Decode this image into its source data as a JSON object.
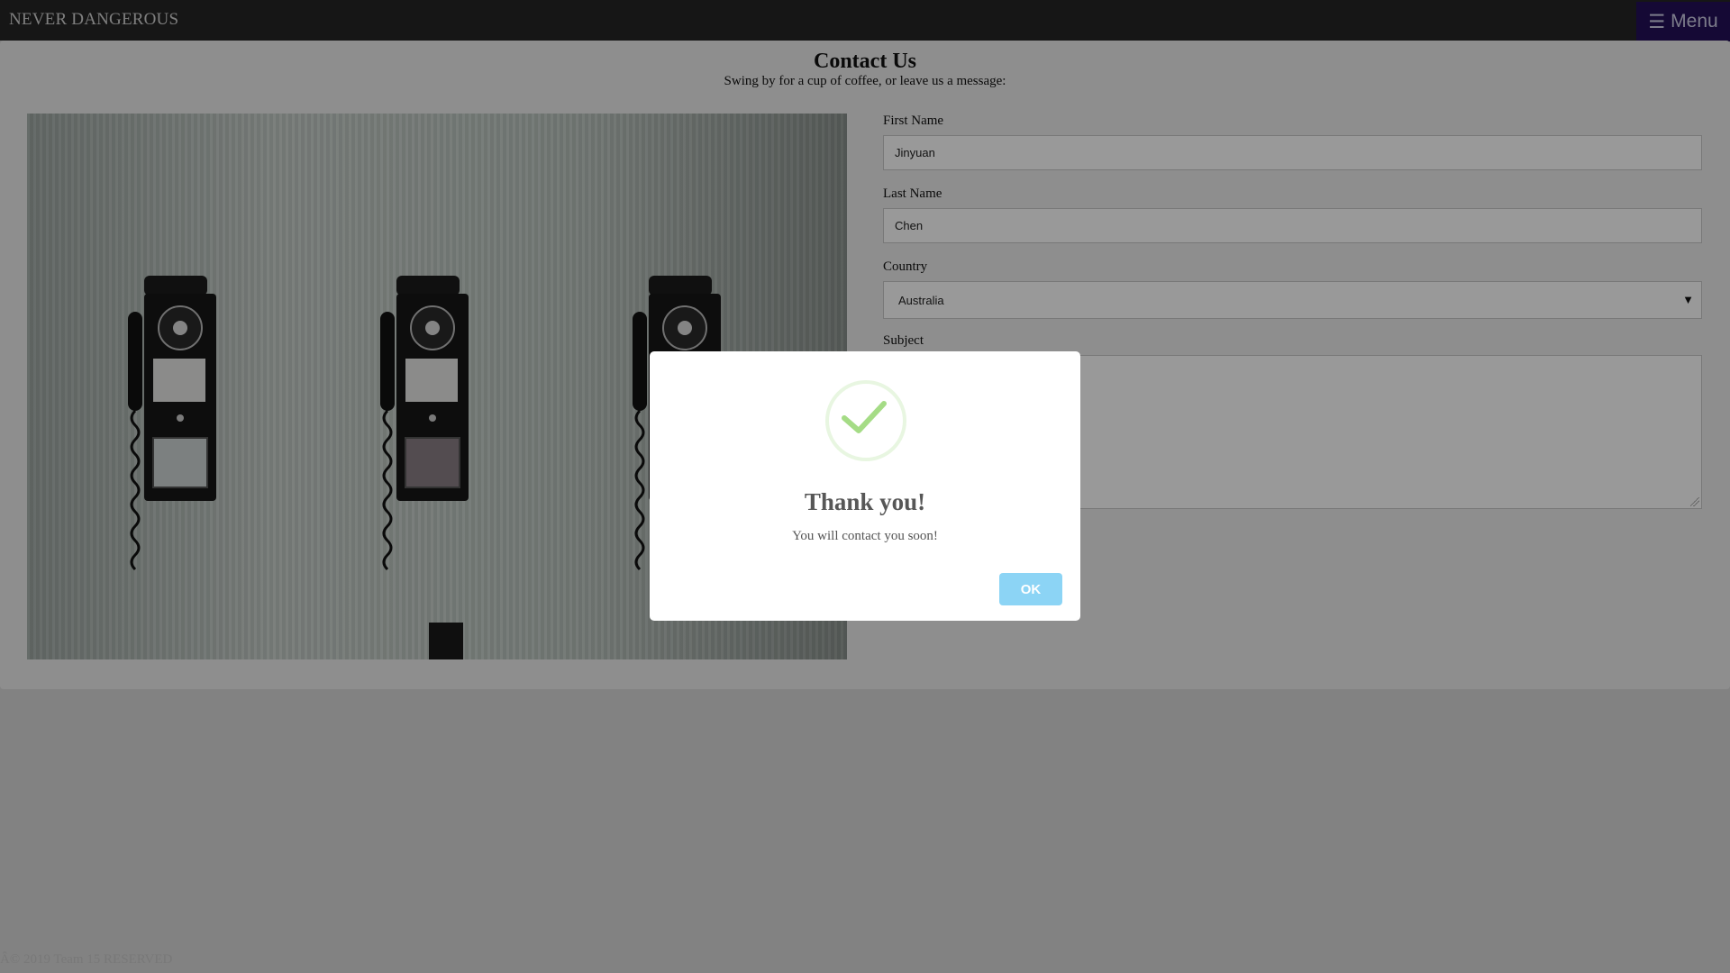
{
  "nav": {
    "brand": "NEVER DANGEROUS",
    "menu_icon": "☰",
    "menu_label": "Menu"
  },
  "header": {
    "title": "Contact Us",
    "subtitle": "Swing by for a cup of coffee, or leave us a message:"
  },
  "form": {
    "first_name": {
      "label": "First Name",
      "value": "Jinyuan"
    },
    "last_name": {
      "label": "Last Name",
      "value": "Chen"
    },
    "country": {
      "label": "Country",
      "value": "Australia",
      "arrow": "▼"
    },
    "subject": {
      "label": "Subject",
      "value": ""
    }
  },
  "footer": {
    "text": "Â© 2019 Team 15 RESERVED"
  },
  "modal": {
    "icon": "success-check-icon",
    "title": "Thank you!",
    "message": "You will contact you soon!",
    "ok_label": "OK",
    "colors": {
      "check": "#a5dc86",
      "ok_button": "#8cd4f5"
    }
  },
  "colors": {
    "nav_bg": "#262626",
    "menu_bg": "#240f59",
    "overlay": "rgba(0,0,0,0.4)"
  }
}
